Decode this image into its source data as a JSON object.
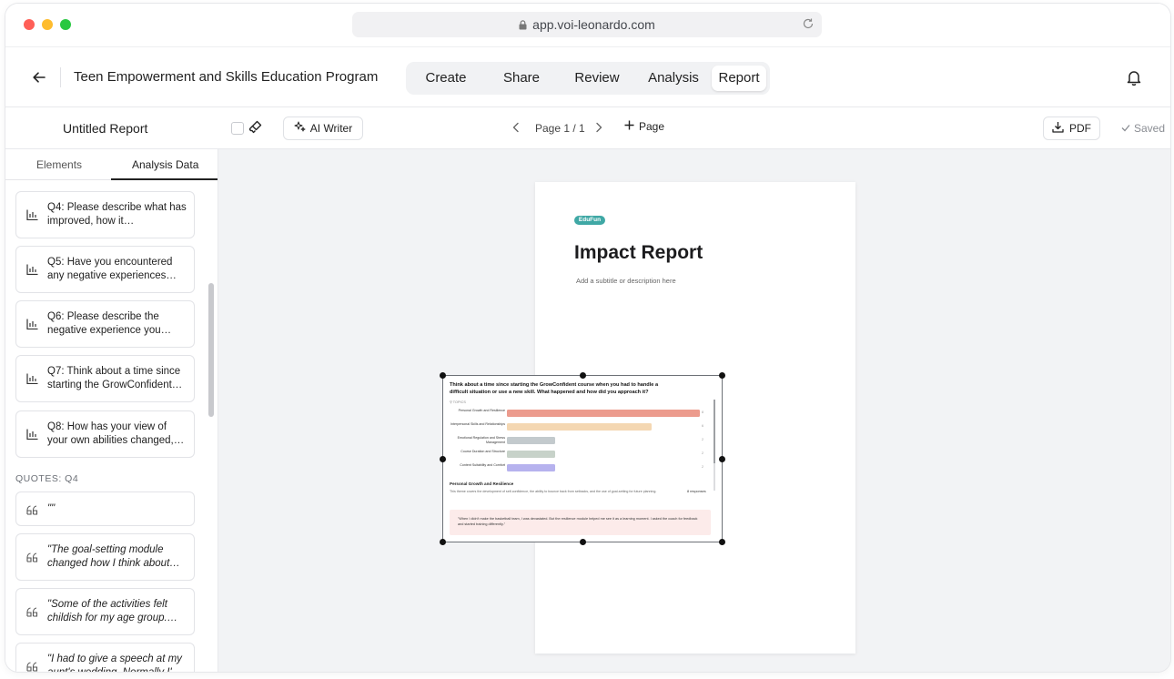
{
  "browser": {
    "url": "app.voi-leonardo.com"
  },
  "header": {
    "project_title": "Teen Empowerment and Skills Education Program",
    "tabs": [
      {
        "label": "Create"
      },
      {
        "label": "Share"
      },
      {
        "label": "Review"
      },
      {
        "label": "Analysis"
      },
      {
        "label": "Report",
        "active": true
      }
    ]
  },
  "toolbar": {
    "report_name": "Untitled Report",
    "ai_writer_label": "AI Writer",
    "page_indicator": "Page 1 / 1",
    "add_page_label": "Page",
    "pdf_label": "PDF",
    "saved_label": "Saved"
  },
  "sidebar": {
    "tabs": [
      {
        "label": "Elements"
      },
      {
        "label": "Analysis Data",
        "active": true
      }
    ],
    "questions": [
      {
        "text": "Q4: Please describe what has improved, how it…"
      },
      {
        "text": "Q5: Have you encountered any negative experiences…"
      },
      {
        "text": "Q6: Please describe the negative experience you…"
      },
      {
        "text": "Q7: Think about a time since starting the GrowConfident…"
      },
      {
        "text": "Q8: How has your view of your own abilities changed,…"
      }
    ],
    "quotes_label": "QUOTES: Q4",
    "quotes": [
      {
        "text": "\"\""
      },
      {
        "text": "\"The goal-setting module changed how I think about…"
      },
      {
        "text": "\"Some of the activities felt childish for my age group.…"
      },
      {
        "text": "\"I had to give a speech at my aunt's wedding. Normally I'…"
      }
    ]
  },
  "report_page": {
    "logo_text": "EduFun",
    "title": "Impact Report",
    "subtitle": "Add a subtitle or description here"
  },
  "selected_element": {
    "question": "Think about a time since starting the GrowConfident course when you had to handle a difficult situation or use a new skill. What happened and how did you approach it?",
    "topics_label": "TOPICS",
    "chart_data": {
      "type": "bar",
      "orientation": "horizontal",
      "categories": [
        "Personal Growth and Resilience",
        "Interpersonal Skills and Relationships",
        "Emotional Regulation and Stress Management",
        "Course Duration and Structure",
        "Content Suitability and Comfort"
      ],
      "values": [
        8,
        6,
        2,
        2,
        2
      ],
      "colors": [
        "#ec9b8d",
        "#f4d7b2",
        "#c3cacd",
        "#c7d2c9",
        "#b6b2ee"
      ],
      "xlim": [
        0,
        8
      ]
    },
    "theme_title": "Personal Growth and Resilience",
    "theme_description": "This theme covers the development of self-confidence, the ability to bounce back from setbacks, and the use of goal-setting for future planning.",
    "theme_responses": "8 responses",
    "quote": "\"When I didn't make the basketball team, I was devastated. But the resilience module helped me see it as a learning moment. I asked the coach for feedback and started training differently.\""
  }
}
